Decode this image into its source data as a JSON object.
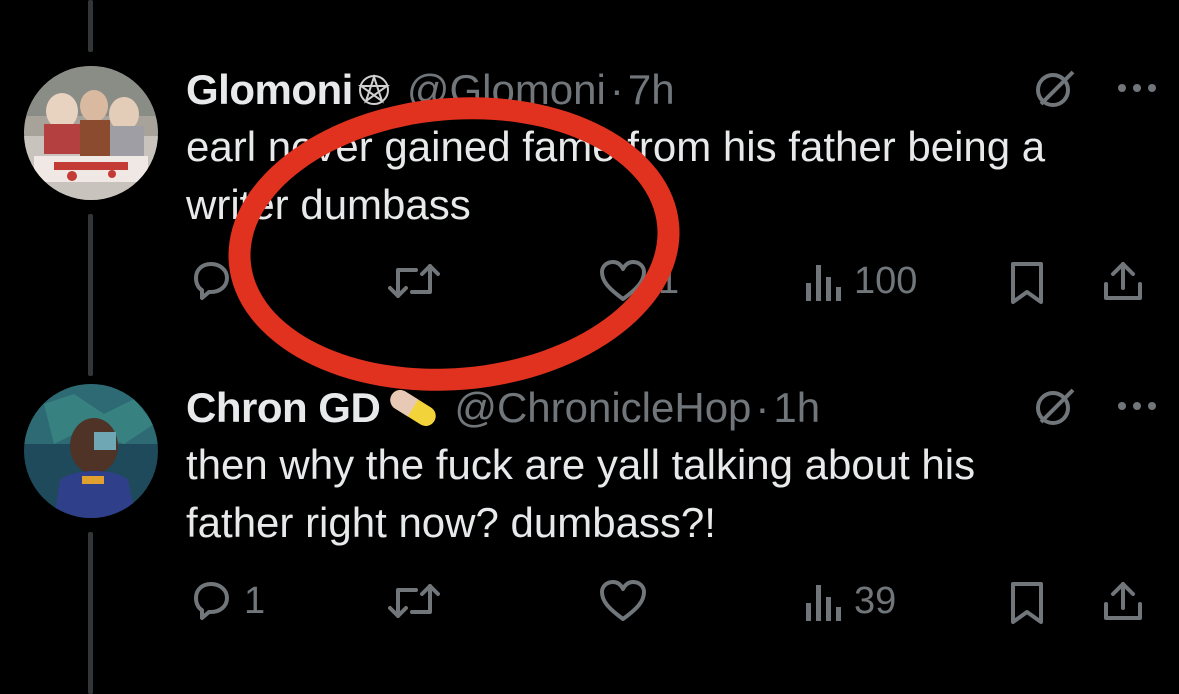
{
  "tweets": [
    {
      "display_name": "Glomoni",
      "name_emoji": "pentagram-icon",
      "handle": "@Glomoni",
      "separator": "·",
      "time": "7h",
      "text_lines": [
        "earl never gained fame from his father being a",
        "writer dumbass"
      ],
      "actions": {
        "replies": "",
        "retweets": "",
        "likes": "1",
        "views": "100"
      }
    },
    {
      "display_name": "Chron GD",
      "name_emoji": "pill-icon",
      "handle": "@ChronicleHop",
      "separator": "·",
      "time": "1h",
      "text_lines": [
        "then why the fuck are yall talking about his",
        "father right now? dumbass?!"
      ],
      "actions": {
        "replies": "1",
        "retweets": "",
        "likes": "",
        "views": "39"
      }
    }
  ],
  "annotation": {
    "shape": "ellipse",
    "color": "#e0321e"
  },
  "colors": {
    "background": "#000000",
    "text": "#e7e9ea",
    "muted": "#71767b",
    "thread_line": "#333639"
  }
}
